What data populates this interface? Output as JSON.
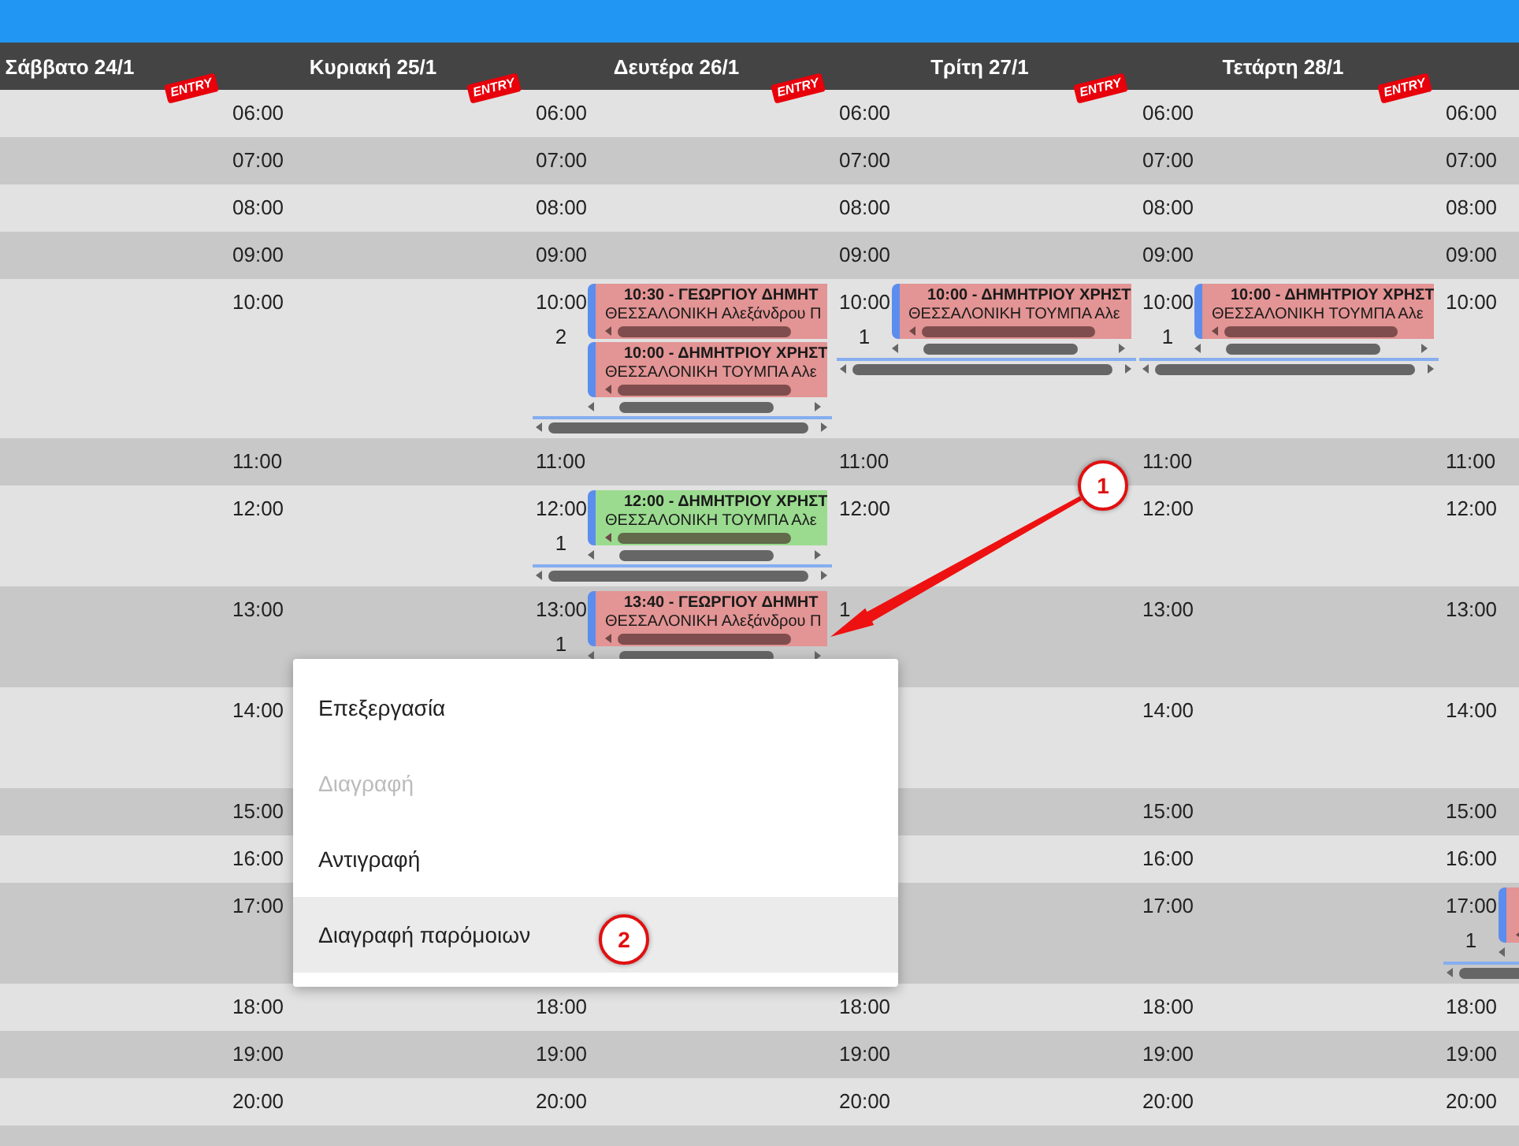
{
  "days": [
    {
      "title": "Σάββατο 24/1",
      "badge": "ENTRY"
    },
    {
      "title": "Κυριακή 25/1",
      "badge": "ENTRY"
    },
    {
      "title": "Δευτέρα 26/1",
      "badge": "ENTRY"
    },
    {
      "title": "Τρίτη 27/1",
      "badge": "ENTRY"
    },
    {
      "title": "Τετάρτη 28/1",
      "badge": "ENTRY"
    }
  ],
  "rows": [
    {
      "cells": [
        {
          "time": "06:00"
        },
        {
          "time": "06:00"
        },
        {
          "time": "06:00"
        },
        {
          "time": "06:00"
        },
        {
          "time": "06:00"
        }
      ]
    },
    {
      "cells": [
        {
          "time": "07:00"
        },
        {
          "time": "07:00"
        },
        {
          "time": "07:00"
        },
        {
          "time": "07:00"
        },
        {
          "time": "07:00"
        }
      ]
    },
    {
      "cells": [
        {
          "time": "08:00"
        },
        {
          "time": "08:00"
        },
        {
          "time": "08:00"
        },
        {
          "time": "08:00"
        },
        {
          "time": "08:00"
        }
      ]
    },
    {
      "cells": [
        {
          "time": "09:00"
        },
        {
          "time": "09:00"
        },
        {
          "time": "09:00"
        },
        {
          "time": "09:00"
        },
        {
          "time": "09:00"
        }
      ]
    },
    {
      "cells": [
        {
          "time": "10:00"
        },
        {
          "time": "10:00",
          "count": "2",
          "events": [
            {
              "title": "10:30 - ΓΕΩΡΓΙΟΥ ΔΗΜΗΤ",
              "location": "ΘΕΣΣΑΛΟΝΙΚΗ Αλεξάνδρου Π",
              "color": "#e39494"
            },
            {
              "title": "10:00 - ΔΗΜΗΤΡΙΟΥ ΧΡΗΣΤ",
              "location": "ΘΕΣΣΑΛΟΝΙΚΗ ΤΟΥΜΠΑ Αλε",
              "color": "#e39494"
            }
          ]
        },
        {
          "time": "10:00",
          "count": "1",
          "events": [
            {
              "title": "10:00 - ΔΗΜΗΤΡΙΟΥ ΧΡΗΣΤ",
              "location": "ΘΕΣΣΑΛΟΝΙΚΗ ΤΟΥΜΠΑ Αλε",
              "color": "#e39494"
            }
          ]
        },
        {
          "time": "10:00",
          "count": "1",
          "events": [
            {
              "title": "10:00 - ΔΗΜΗΤΡΙΟΥ ΧΡΗΣΤ",
              "location": "ΘΕΣΣΑΛΟΝΙΚΗ ΤΟΥΜΠΑ Αλε",
              "color": "#e39494"
            }
          ]
        },
        {
          "time": "10:00"
        }
      ]
    },
    {
      "cells": [
        {
          "time": "11:00"
        },
        {
          "time": "11:00"
        },
        {
          "time": "11:00"
        },
        {
          "time": "11:00"
        },
        {
          "time": "11:00"
        }
      ]
    },
    {
      "cells": [
        {
          "time": "12:00"
        },
        {
          "time": "12:00",
          "count": "1",
          "events": [
            {
              "title": "12:00 - ΔΗΜΗΤΡΙΟΥ ΧΡΗΣΤ",
              "location": "ΘΕΣΣΑΛΟΝΙΚΗ ΤΟΥΜΠΑ Αλε",
              "color": "#9bdb90"
            }
          ]
        },
        {
          "time": "12:00"
        },
        {
          "time": "12:00"
        },
        {
          "time": "12:00"
        }
      ]
    },
    {
      "cells": [
        {
          "time": "13:00"
        },
        {
          "time": "13:00",
          "count": "1",
          "events": [
            {
              "title": "13:40 - ΓΕΩΡΓΙΟΥ ΔΗΜΗΤ",
              "location": "ΘΕΣΣΑΛΟΝΙΚΗ Αλεξάνδρου Π",
              "color": "#e39494"
            }
          ]
        },
        {
          "time": "1"
        },
        {
          "time": "13:00"
        },
        {
          "time": "13:00"
        }
      ]
    },
    {
      "expanded": true,
      "cells": [
        {
          "time": "14:00"
        },
        {},
        {},
        {
          "time": "14:00"
        },
        {
          "time": "14:00"
        }
      ]
    },
    {
      "cells": [
        {
          "time": "15:00"
        },
        {},
        {},
        {
          "time": "15:00"
        },
        {
          "time": "15:00"
        }
      ]
    },
    {
      "cells": [
        {
          "time": "16:00"
        },
        {},
        {},
        {
          "time": "16:00"
        },
        {
          "time": "16:00"
        }
      ]
    },
    {
      "cells": [
        {
          "time": "17:00"
        },
        {},
        {},
        {
          "time": "17:00"
        },
        {
          "time": "17:00",
          "count": "1",
          "events": [
            {
              "color": "#e39494"
            }
          ]
        }
      ]
    },
    {
      "cells": [
        {
          "time": "18:00"
        },
        {
          "time": "18:00"
        },
        {
          "time": "18:00"
        },
        {
          "time": "18:00"
        },
        {
          "time": "18:00"
        }
      ]
    },
    {
      "cells": [
        {
          "time": "19:00"
        },
        {
          "time": "19:00"
        },
        {
          "time": "19:00"
        },
        {
          "time": "19:00"
        },
        {
          "time": "19:00"
        }
      ]
    },
    {
      "cells": [
        {
          "time": "20:00"
        },
        {
          "time": "20:00"
        },
        {
          "time": "20:00"
        },
        {
          "time": "20:00"
        },
        {
          "time": "20:00"
        }
      ]
    }
  ],
  "context_menu": {
    "items": [
      {
        "label": "Επεξεργασία",
        "disabled": false,
        "selected": false
      },
      {
        "label": "Διαγραφή",
        "disabled": true,
        "selected": false
      },
      {
        "label": "Αντιγραφή",
        "disabled": false,
        "selected": false
      },
      {
        "label": "Διαγραφή παρόμοιων",
        "disabled": false,
        "selected": true
      }
    ]
  },
  "annotations": [
    {
      "label": "1"
    },
    {
      "label": "2"
    }
  ]
}
